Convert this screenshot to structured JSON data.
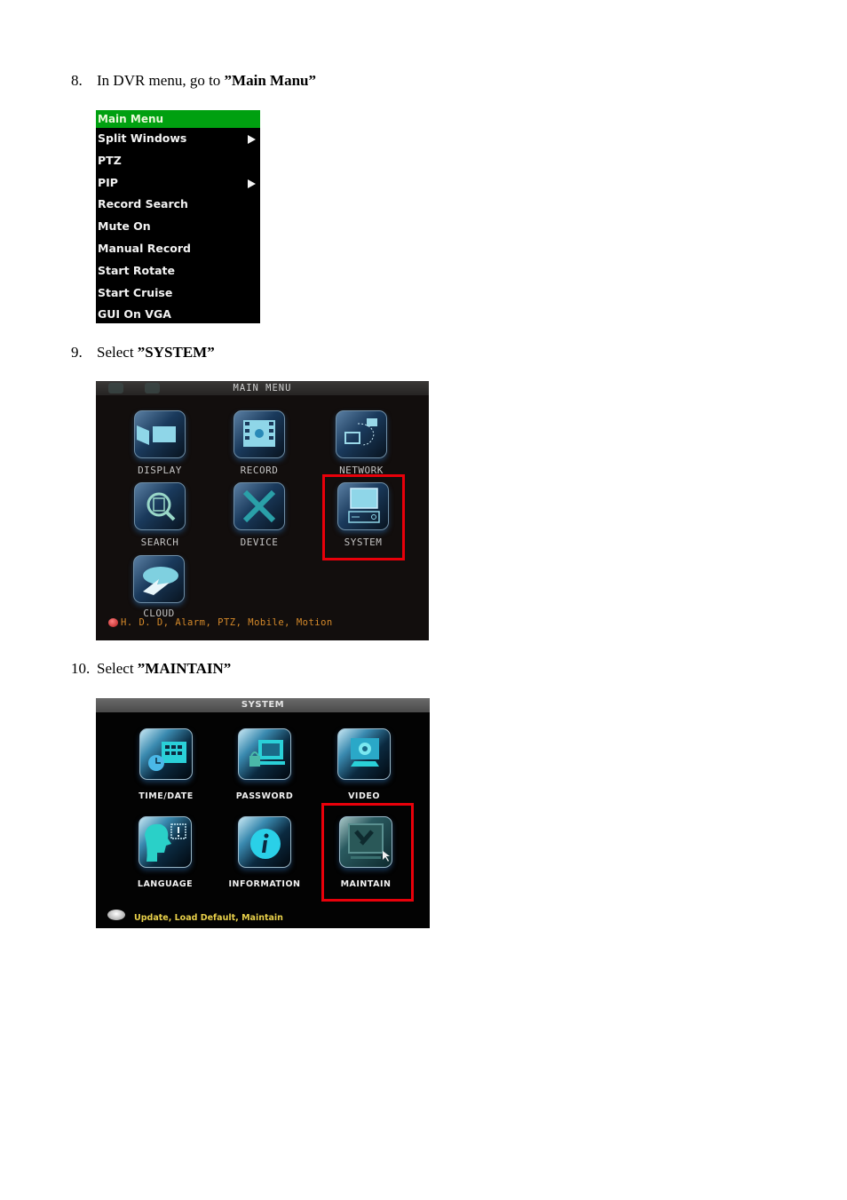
{
  "steps": [
    {
      "number": "8.",
      "text": "In DVR menu, go to ",
      "emphasis": "”Main Manu”"
    },
    {
      "number": "9.",
      "text": "Select ",
      "emphasis": "”SYSTEM”"
    },
    {
      "number": "10.",
      "text": "Select ",
      "emphasis": "”MAINTAIN”"
    }
  ],
  "main_menu": {
    "title": "Main  Menu",
    "items": [
      {
        "label": "Split  Windows",
        "submenu": true
      },
      {
        "label": "PTZ",
        "submenu": false
      },
      {
        "label": "PIP",
        "submenu": true
      },
      {
        "label": "Record  Search",
        "submenu": false
      },
      {
        "label": "Mute  On",
        "submenu": false
      },
      {
        "label": "Manual  Record",
        "submenu": false
      },
      {
        "label": "Start  Rotate",
        "submenu": false
      },
      {
        "label": "Start  Cruise",
        "submenu": false
      },
      {
        "label": "GUI  On  VGA",
        "submenu": false
      }
    ]
  },
  "main_menu_grid": {
    "title": "MAIN MENU",
    "tiles": [
      {
        "label": "DISPLAY",
        "icon": "display-icon"
      },
      {
        "label": "RECORD",
        "icon": "film-icon"
      },
      {
        "label": "NETWORK",
        "icon": "network-icon"
      },
      {
        "label": "SEARCH",
        "icon": "magnifier-icon"
      },
      {
        "label": "DEVICE",
        "icon": "tools-icon"
      },
      {
        "label": "SYSTEM",
        "icon": "computer-icon",
        "highlighted": true
      },
      {
        "label": "CLOUD",
        "icon": "cloud-icon"
      }
    ],
    "status": "H. D. D, Alarm, PTZ, Mobile, Motion",
    "highlight_color": "#e8000a"
  },
  "system_grid": {
    "title": "SYSTEM",
    "tiles": [
      {
        "label": "TIME/DATE",
        "icon": "calendar-clock-icon"
      },
      {
        "label": "PASSWORD",
        "icon": "lock-computer-icon"
      },
      {
        "label": "VIDEO",
        "icon": "video-monitor-icon"
      },
      {
        "label": "LANGUAGE",
        "icon": "speaking-head-icon"
      },
      {
        "label": "INFORMATION",
        "icon": "info-icon"
      },
      {
        "label": "MAINTAIN",
        "icon": "maintain-icon",
        "highlighted": true
      }
    ],
    "status": "Update, Load  Default, Maintain"
  }
}
